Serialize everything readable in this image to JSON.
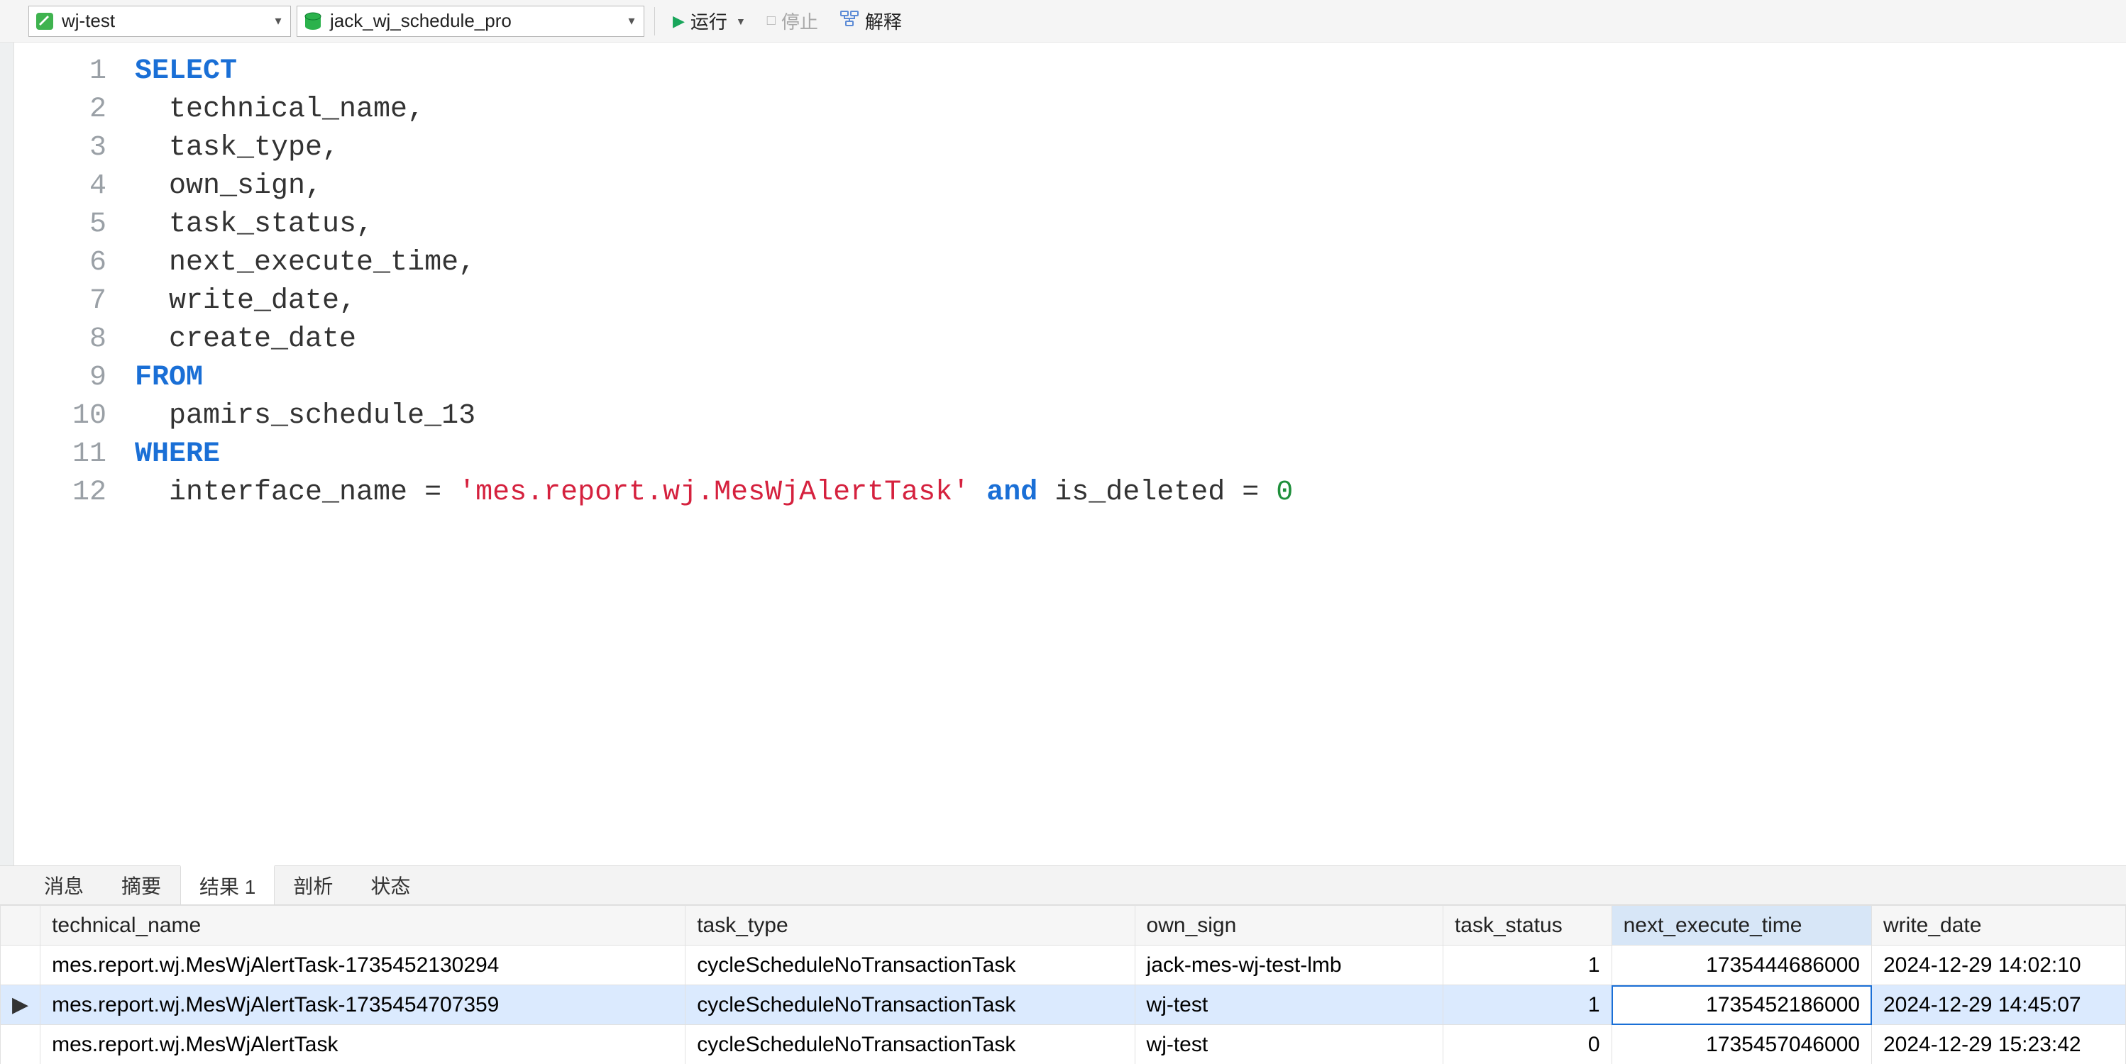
{
  "toolbar": {
    "connection": "wj-test",
    "database": "jack_wj_schedule_pro",
    "run_label": "运行",
    "stop_label": "停止",
    "explain_label": "解释"
  },
  "sql": {
    "lines": [
      [
        {
          "t": "SELECT",
          "c": "kw"
        }
      ],
      [
        {
          "t": "  technical_name,",
          "c": ""
        }
      ],
      [
        {
          "t": "  task_type,",
          "c": ""
        }
      ],
      [
        {
          "t": "  own_sign,",
          "c": ""
        }
      ],
      [
        {
          "t": "  task_status,",
          "c": ""
        }
      ],
      [
        {
          "t": "  next_execute_time,",
          "c": ""
        }
      ],
      [
        {
          "t": "  write_date,",
          "c": ""
        }
      ],
      [
        {
          "t": "  create_date",
          "c": ""
        }
      ],
      [
        {
          "t": "FROM",
          "c": "kw"
        }
      ],
      [
        {
          "t": "  pamirs_schedule_13",
          "c": ""
        }
      ],
      [
        {
          "t": "WHERE",
          "c": "kw"
        }
      ],
      [
        {
          "t": "  interface_name = ",
          "c": ""
        },
        {
          "t": "'mes.report.wj.MesWjAlertTask'",
          "c": "str"
        },
        {
          "t": " ",
          "c": ""
        },
        {
          "t": "and",
          "c": "kw"
        },
        {
          "t": " is_deleted = ",
          "c": ""
        },
        {
          "t": "0",
          "c": "num"
        }
      ]
    ],
    "line_count": 12
  },
  "tabs": {
    "items": [
      "消息",
      "摘要",
      "结果 1",
      "剖析",
      "状态"
    ],
    "active_index": 2
  },
  "results": {
    "columns": [
      "technical_name",
      "task_type",
      "own_sign",
      "task_status",
      "next_execute_time",
      "write_date"
    ],
    "sorted_column_index": 4,
    "numeric_columns": [
      3,
      4
    ],
    "selected_row_index": 1,
    "focused_cell": {
      "row": 1,
      "col": 4
    },
    "rows": [
      {
        "pointer": "",
        "cells": [
          "mes.report.wj.MesWjAlertTask-1735452130294",
          "cycleScheduleNoTransactionTask",
          "jack-mes-wj-test-lmb",
          "1",
          "1735444686000",
          "2024-12-29 14:02:10"
        ]
      },
      {
        "pointer": "▶",
        "cells": [
          "mes.report.wj.MesWjAlertTask-1735454707359",
          "cycleScheduleNoTransactionTask",
          "wj-test",
          "1",
          "1735452186000",
          "2024-12-29 14:45:07"
        ]
      },
      {
        "pointer": "",
        "cells": [
          "mes.report.wj.MesWjAlertTask",
          "cycleScheduleNoTransactionTask",
          "wj-test",
          "0",
          "1735457046000",
          "2024-12-29 15:23:42"
        ]
      }
    ]
  }
}
